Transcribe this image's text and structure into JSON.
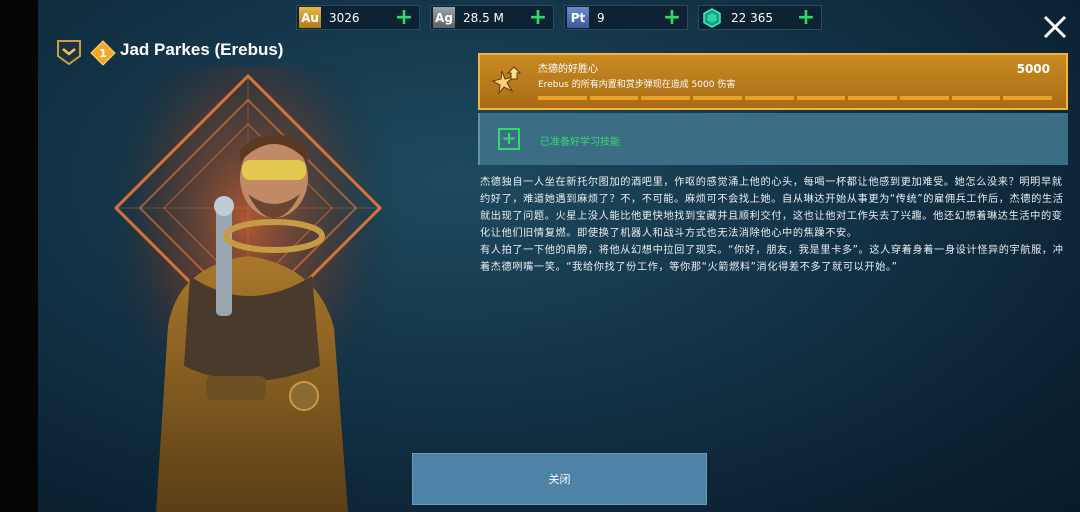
{
  "resources": [
    {
      "symbol": "Au",
      "value": "3026",
      "icon": "gold-icon",
      "color": "#d9a436"
    },
    {
      "symbol": "Ag",
      "value": "28.5 M",
      "icon": "silver-icon",
      "color": "#8a949a"
    },
    {
      "symbol": "Pt",
      "value": "9",
      "icon": "platinum-icon",
      "color": "#5a7ab8"
    },
    {
      "symbol": "",
      "value": "22 365",
      "icon": "gem-icon",
      "color": "#2fd3a8"
    }
  ],
  "character": {
    "level": "1",
    "name": "Jad Parkes (Erebus)"
  },
  "achievement": {
    "title": "杰德的好胜心",
    "description": "Erebus 的所有内置和赏步弹现在造成 5000 伤害",
    "value": "5000",
    "progress_segments_filled": 10,
    "progress_segments_total": 10
  },
  "skill": {
    "label": "已准备好学习技能"
  },
  "story": {
    "paragraphs": [
      "杰德独自一人坐在新托尔图加的酒吧里，作呕的感觉涌上他的心头，每喝一杯都让他感到更加难受。她怎么没来？明明早就约好了，难道她遇到麻烦了？不，不可能。麻烦可不会找上她。自从琳达开始从事更为“传统”的雇佣兵工作后，杰德的生活就出现了问题。火星上没人能比他更快地找到宝藏并且顺利交付，这也让他对工作失去了兴趣。他还幻想着琳达生活中的变化让他们旧情复燃。即使换了机器人和战斗方式也无法消除他心中的焦躁不安。",
      "有人拍了一下他的肩膀，将他从幻想中拉回了现实。“你好，朋友，我是里卡多”。这人穿着身着一身设计怪异的宇航服，冲着杰德咧嘴一笑。“我给你找了份工作，等你那“火箭燃料”消化得差不多了就可以开始。”"
    ]
  },
  "buttons": {
    "close": "关闭"
  },
  "colors": {
    "accent_gold": "#f2b640",
    "green": "#35d86c",
    "button_blue": "#4e83a6"
  }
}
